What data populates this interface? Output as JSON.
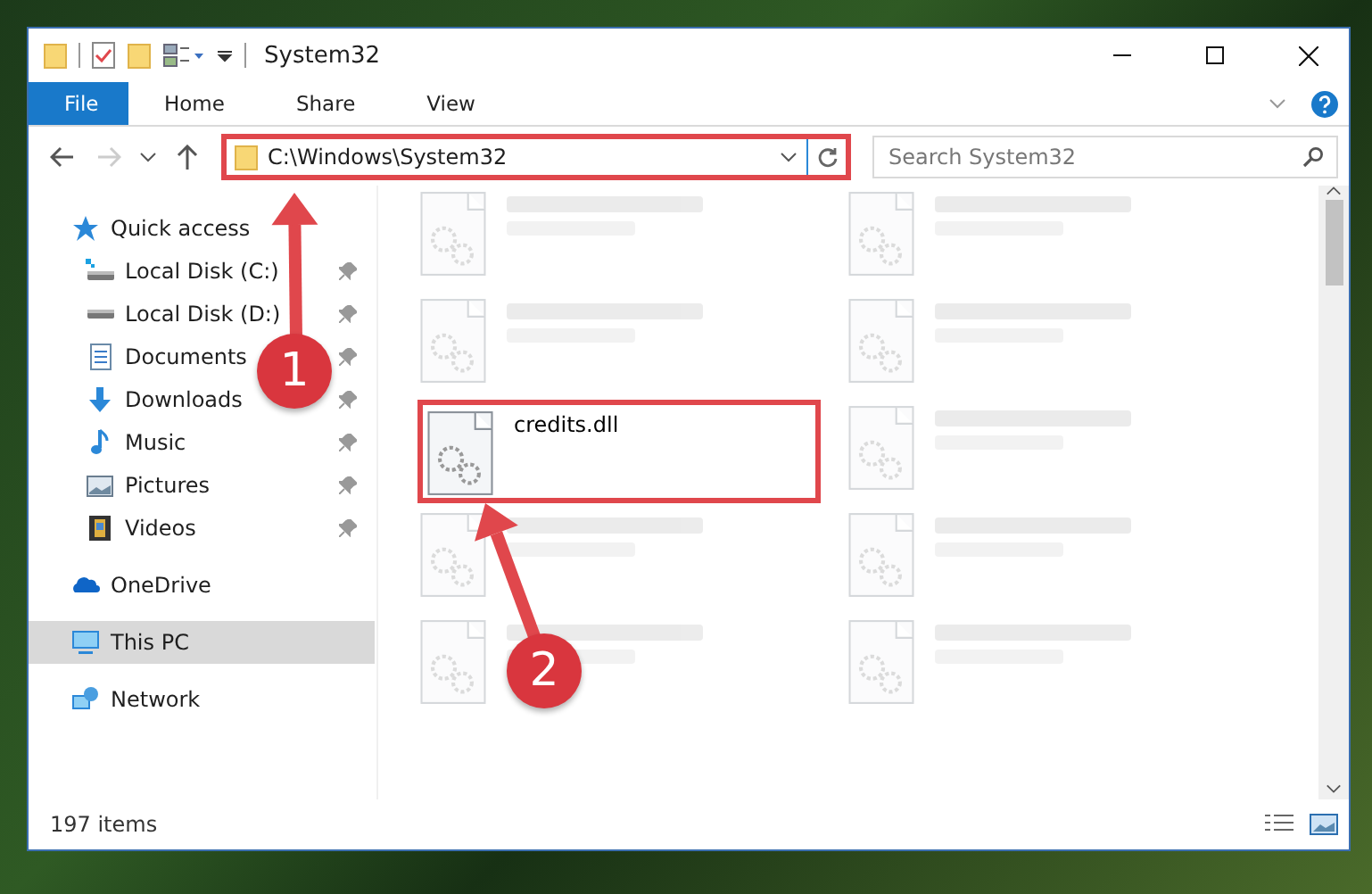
{
  "window": {
    "title": "System32"
  },
  "ribbon_tabs": [
    {
      "label": "File",
      "kind": "menu"
    },
    {
      "label": "Home",
      "kind": "tab"
    },
    {
      "label": "Share",
      "kind": "tab"
    },
    {
      "label": "View",
      "kind": "tab"
    }
  ],
  "address_bar": {
    "path": "C:\\Windows\\System32",
    "highlighted": true
  },
  "search": {
    "placeholder": "Search System32"
  },
  "navigation": [
    {
      "label": "Quick access",
      "kind": "star",
      "selected": false,
      "children": [
        {
          "label": "Local Disk (C:)",
          "kind": "sysdrive",
          "pinned": true,
          "selected": false
        },
        {
          "label": "Local Disk (D:)",
          "kind": "drive",
          "pinned": true,
          "selected": false
        },
        {
          "label": "Documents",
          "kind": "document",
          "pinned": true,
          "selected": false
        },
        {
          "label": "Downloads",
          "kind": "download",
          "pinned": true,
          "selected": false
        },
        {
          "label": "Music",
          "kind": "music",
          "pinned": true,
          "selected": false
        },
        {
          "label": "Pictures",
          "kind": "picture",
          "pinned": true,
          "selected": false
        },
        {
          "label": "Videos",
          "kind": "video",
          "pinned": true,
          "selected": false
        }
      ]
    },
    {
      "label": "OneDrive",
      "kind": "cloud",
      "selected": false
    },
    {
      "label": "This PC",
      "kind": "computer",
      "selected": true
    },
    {
      "label": "Network",
      "kind": "network",
      "selected": false
    }
  ],
  "files": [
    {
      "blurred": true,
      "highlighted": false
    },
    {
      "blurred": true,
      "highlighted": false
    },
    {
      "blurred": true,
      "highlighted": false
    },
    {
      "blurred": true,
      "highlighted": false
    },
    {
      "name": "credits.dll",
      "blurred": false,
      "highlighted": true
    },
    {
      "blurred": true,
      "highlighted": false
    },
    {
      "blurred": true,
      "highlighted": false
    },
    {
      "blurred": true,
      "highlighted": false
    },
    {
      "blurred": true,
      "highlighted": false
    },
    {
      "blurred": true,
      "highlighted": false
    }
  ],
  "callouts": [
    {
      "label": "1"
    },
    {
      "label": "2"
    }
  ],
  "status_bar": {
    "item_count": "197 items"
  }
}
